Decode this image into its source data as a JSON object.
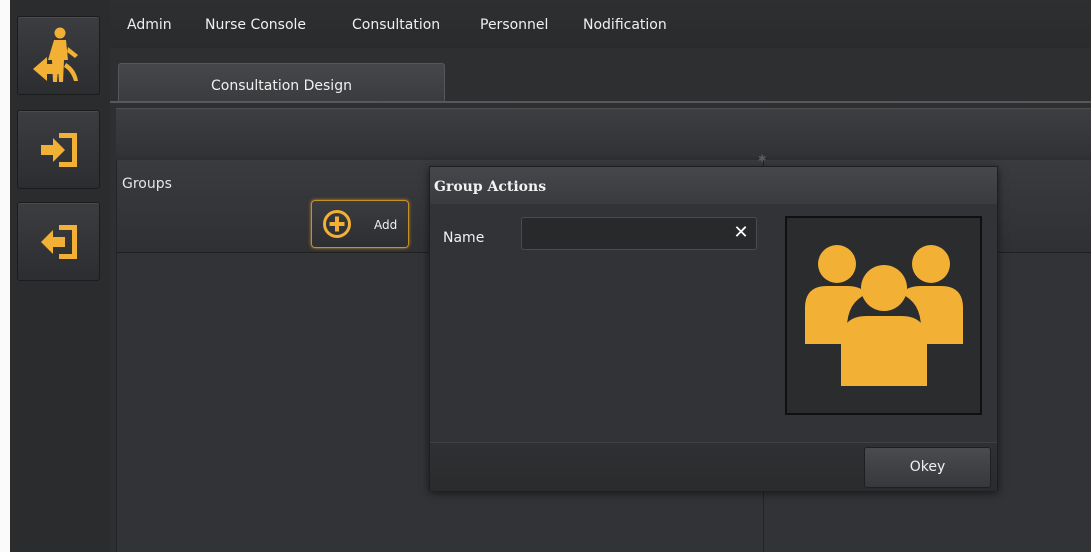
{
  "menu": {
    "items": [
      "Admin",
      "Nurse Console",
      "Consultation",
      "Personnel",
      "Nodification"
    ]
  },
  "tabs": [
    {
      "label": "Consultation Design",
      "active": true
    }
  ],
  "sidebar": {
    "buttons": [
      {
        "icon": "caregiver-walk-icon"
      },
      {
        "icon": "login-icon"
      },
      {
        "icon": "logout-icon"
      }
    ]
  },
  "groups": {
    "title": "Groups",
    "add_label": "Add"
  },
  "dialog": {
    "title": "Group Actions",
    "name_label": "Name",
    "name_value": "",
    "image_icon": "group-people-icon",
    "ok_label": "Okey"
  },
  "colors": {
    "accent": "#f2b134",
    "background": "#2e2f31",
    "panel": "#323336"
  }
}
